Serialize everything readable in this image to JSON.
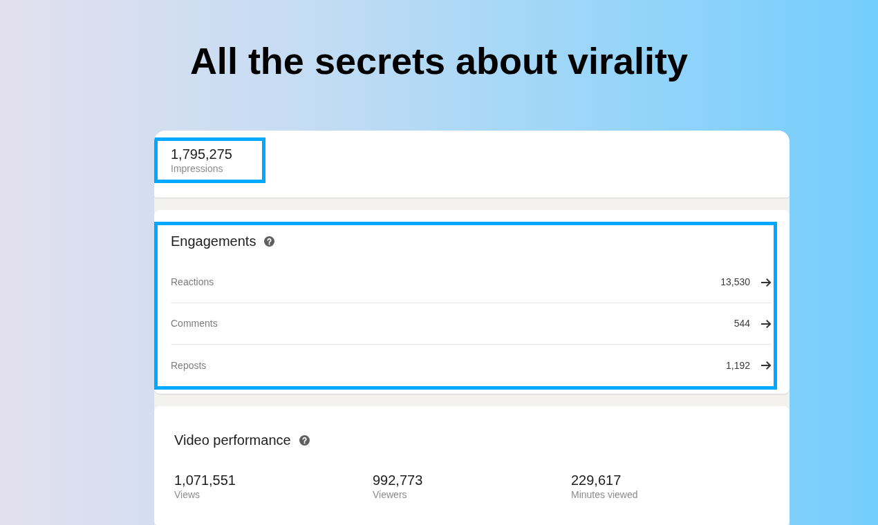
{
  "title": "All the secrets about virality",
  "impressions": {
    "value": "1,795,275",
    "label": "Impressions",
    "highlighted": true
  },
  "engagements": {
    "title": "Engagements",
    "highlighted": true,
    "rows": [
      {
        "label": "Reactions",
        "value": "13,530"
      },
      {
        "label": "Comments",
        "value": "544"
      },
      {
        "label": "Reposts",
        "value": "1,192"
      }
    ]
  },
  "video_performance": {
    "title": "Video performance",
    "stats": [
      {
        "value": "1,071,551",
        "label": "Views"
      },
      {
        "value": "992,773",
        "label": "Viewers"
      },
      {
        "value": "229,617",
        "label": "Minutes viewed"
      }
    ]
  }
}
